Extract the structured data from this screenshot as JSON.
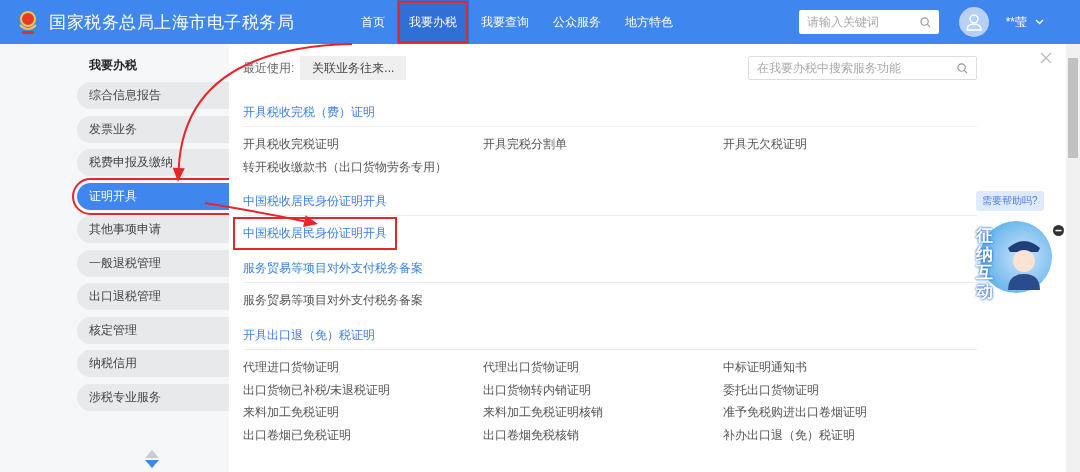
{
  "header": {
    "site_title": "国家税务总局上海市电子税务局",
    "nav": [
      {
        "label": "首页",
        "selected": false,
        "highlighted": false
      },
      {
        "label": "我要办税",
        "selected": true,
        "highlighted": true
      },
      {
        "label": "我要查询",
        "selected": false,
        "highlighted": false
      },
      {
        "label": "公众服务",
        "selected": false,
        "highlighted": false
      },
      {
        "label": "地方特色",
        "selected": false,
        "highlighted": false
      }
    ],
    "search": {
      "placeholder": "请输入关键词"
    },
    "user": {
      "name": "**莹"
    }
  },
  "sidebar": {
    "title": "我要办税",
    "items": [
      {
        "label": "综合信息报告",
        "selected": false,
        "highlighted": false
      },
      {
        "label": "发票业务",
        "selected": false,
        "highlighted": false
      },
      {
        "label": "税费申报及缴纳",
        "selected": false,
        "highlighted": false
      },
      {
        "label": "证明开具",
        "selected": true,
        "highlighted": true
      },
      {
        "label": "其他事项申请",
        "selected": false,
        "highlighted": false
      },
      {
        "label": "一般退税管理",
        "selected": false,
        "highlighted": false
      },
      {
        "label": "出口退税管理",
        "selected": false,
        "highlighted": false
      },
      {
        "label": "核定管理",
        "selected": false,
        "highlighted": false
      },
      {
        "label": "纳税信用",
        "selected": false,
        "highlighted": false
      },
      {
        "label": "涉税专业服务",
        "selected": false,
        "highlighted": false
      }
    ]
  },
  "main": {
    "recent_label": "最近使用:",
    "recent": [
      "关联业务往来..."
    ],
    "search": {
      "placeholder": "在我要办税中搜索服务功能"
    },
    "sections": [
      {
        "title": "开具税收完税（费）证明",
        "items": [
          {
            "label": "开具税收完税证明",
            "kind": "plain"
          },
          {
            "label": "开具完税分割单",
            "kind": "plain"
          },
          {
            "label": "开具无欠税证明",
            "kind": "plain"
          },
          {
            "label": "转开税收缴款书（出口货物劳务专用）",
            "kind": "plain"
          }
        ]
      },
      {
        "title": "中国税收居民身份证明开具",
        "items": [
          {
            "label": "中国税收居民身份证明开具",
            "kind": "link",
            "highlighted": true
          }
        ]
      },
      {
        "title": "服务贸易等项目对外支付税务备案",
        "items": [
          {
            "label": "服务贸易等项目对外支付税务备案",
            "kind": "plain"
          }
        ]
      },
      {
        "title": "开具出口退（免）税证明",
        "items": [
          {
            "label": "代理进口货物证明",
            "kind": "plain"
          },
          {
            "label": "代理出口货物证明",
            "kind": "plain"
          },
          {
            "label": "中标证明通知书",
            "kind": "plain"
          },
          {
            "label": "出口货物已补税/未退税证明",
            "kind": "plain"
          },
          {
            "label": "出口货物转内销证明",
            "kind": "plain"
          },
          {
            "label": "委托出口货物证明",
            "kind": "plain"
          },
          {
            "label": "来料加工免税证明",
            "kind": "plain"
          },
          {
            "label": "来料加工免税证明核销",
            "kind": "plain"
          },
          {
            "label": "准予免税购进出口卷烟证明",
            "kind": "plain"
          },
          {
            "label": "出口卷烟已免税证明",
            "kind": "plain"
          },
          {
            "label": "出口卷烟免税核销",
            "kind": "plain"
          },
          {
            "label": "补办出口退（免）税证明",
            "kind": "plain"
          }
        ]
      }
    ]
  },
  "help": {
    "bubble": "需要帮助吗?",
    "label": "征纳互动"
  },
  "annotations": {
    "arrows": true
  }
}
